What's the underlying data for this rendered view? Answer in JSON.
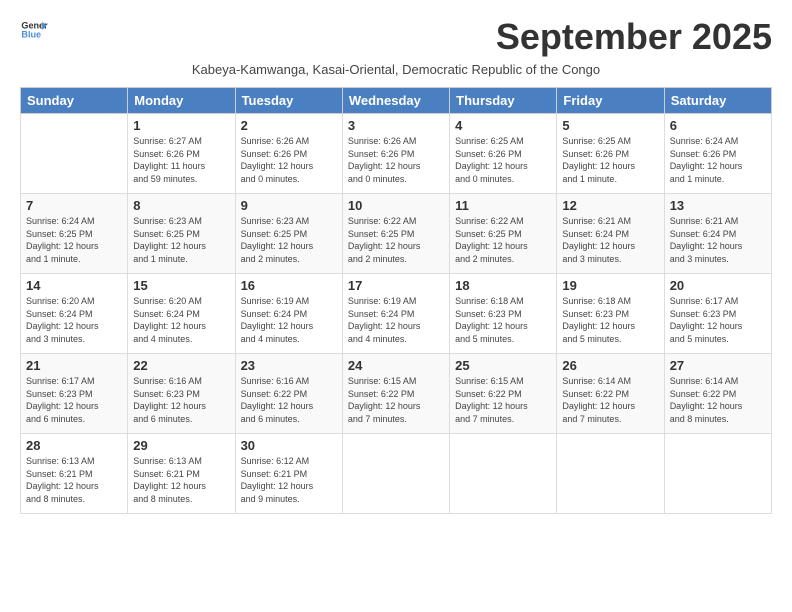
{
  "header": {
    "logo_line1": "General",
    "logo_line2": "Blue",
    "month": "September 2025",
    "subtitle": "Kabeya-Kamwanga, Kasai-Oriental, Democratic Republic of the Congo"
  },
  "days_of_week": [
    "Sunday",
    "Monday",
    "Tuesday",
    "Wednesday",
    "Thursday",
    "Friday",
    "Saturday"
  ],
  "weeks": [
    [
      {
        "day": "",
        "info": ""
      },
      {
        "day": "1",
        "info": "Sunrise: 6:27 AM\nSunset: 6:26 PM\nDaylight: 11 hours\nand 59 minutes."
      },
      {
        "day": "2",
        "info": "Sunrise: 6:26 AM\nSunset: 6:26 PM\nDaylight: 12 hours\nand 0 minutes."
      },
      {
        "day": "3",
        "info": "Sunrise: 6:26 AM\nSunset: 6:26 PM\nDaylight: 12 hours\nand 0 minutes."
      },
      {
        "day": "4",
        "info": "Sunrise: 6:25 AM\nSunset: 6:26 PM\nDaylight: 12 hours\nand 0 minutes."
      },
      {
        "day": "5",
        "info": "Sunrise: 6:25 AM\nSunset: 6:26 PM\nDaylight: 12 hours\nand 1 minute."
      },
      {
        "day": "6",
        "info": "Sunrise: 6:24 AM\nSunset: 6:26 PM\nDaylight: 12 hours\nand 1 minute."
      }
    ],
    [
      {
        "day": "7",
        "info": "Sunrise: 6:24 AM\nSunset: 6:25 PM\nDaylight: 12 hours\nand 1 minute."
      },
      {
        "day": "8",
        "info": "Sunrise: 6:23 AM\nSunset: 6:25 PM\nDaylight: 12 hours\nand 1 minute."
      },
      {
        "day": "9",
        "info": "Sunrise: 6:23 AM\nSunset: 6:25 PM\nDaylight: 12 hours\nand 2 minutes."
      },
      {
        "day": "10",
        "info": "Sunrise: 6:22 AM\nSunset: 6:25 PM\nDaylight: 12 hours\nand 2 minutes."
      },
      {
        "day": "11",
        "info": "Sunrise: 6:22 AM\nSunset: 6:25 PM\nDaylight: 12 hours\nand 2 minutes."
      },
      {
        "day": "12",
        "info": "Sunrise: 6:21 AM\nSunset: 6:24 PM\nDaylight: 12 hours\nand 3 minutes."
      },
      {
        "day": "13",
        "info": "Sunrise: 6:21 AM\nSunset: 6:24 PM\nDaylight: 12 hours\nand 3 minutes."
      }
    ],
    [
      {
        "day": "14",
        "info": "Sunrise: 6:20 AM\nSunset: 6:24 PM\nDaylight: 12 hours\nand 3 minutes."
      },
      {
        "day": "15",
        "info": "Sunrise: 6:20 AM\nSunset: 6:24 PM\nDaylight: 12 hours\nand 4 minutes."
      },
      {
        "day": "16",
        "info": "Sunrise: 6:19 AM\nSunset: 6:24 PM\nDaylight: 12 hours\nand 4 minutes."
      },
      {
        "day": "17",
        "info": "Sunrise: 6:19 AM\nSunset: 6:24 PM\nDaylight: 12 hours\nand 4 minutes."
      },
      {
        "day": "18",
        "info": "Sunrise: 6:18 AM\nSunset: 6:23 PM\nDaylight: 12 hours\nand 5 minutes."
      },
      {
        "day": "19",
        "info": "Sunrise: 6:18 AM\nSunset: 6:23 PM\nDaylight: 12 hours\nand 5 minutes."
      },
      {
        "day": "20",
        "info": "Sunrise: 6:17 AM\nSunset: 6:23 PM\nDaylight: 12 hours\nand 5 minutes."
      }
    ],
    [
      {
        "day": "21",
        "info": "Sunrise: 6:17 AM\nSunset: 6:23 PM\nDaylight: 12 hours\nand 6 minutes."
      },
      {
        "day": "22",
        "info": "Sunrise: 6:16 AM\nSunset: 6:23 PM\nDaylight: 12 hours\nand 6 minutes."
      },
      {
        "day": "23",
        "info": "Sunrise: 6:16 AM\nSunset: 6:22 PM\nDaylight: 12 hours\nand 6 minutes."
      },
      {
        "day": "24",
        "info": "Sunrise: 6:15 AM\nSunset: 6:22 PM\nDaylight: 12 hours\nand 7 minutes."
      },
      {
        "day": "25",
        "info": "Sunrise: 6:15 AM\nSunset: 6:22 PM\nDaylight: 12 hours\nand 7 minutes."
      },
      {
        "day": "26",
        "info": "Sunrise: 6:14 AM\nSunset: 6:22 PM\nDaylight: 12 hours\nand 7 minutes."
      },
      {
        "day": "27",
        "info": "Sunrise: 6:14 AM\nSunset: 6:22 PM\nDaylight: 12 hours\nand 8 minutes."
      }
    ],
    [
      {
        "day": "28",
        "info": "Sunrise: 6:13 AM\nSunset: 6:21 PM\nDaylight: 12 hours\nand 8 minutes."
      },
      {
        "day": "29",
        "info": "Sunrise: 6:13 AM\nSunset: 6:21 PM\nDaylight: 12 hours\nand 8 minutes."
      },
      {
        "day": "30",
        "info": "Sunrise: 6:12 AM\nSunset: 6:21 PM\nDaylight: 12 hours\nand 9 minutes."
      },
      {
        "day": "",
        "info": ""
      },
      {
        "day": "",
        "info": ""
      },
      {
        "day": "",
        "info": ""
      },
      {
        "day": "",
        "info": ""
      }
    ]
  ]
}
